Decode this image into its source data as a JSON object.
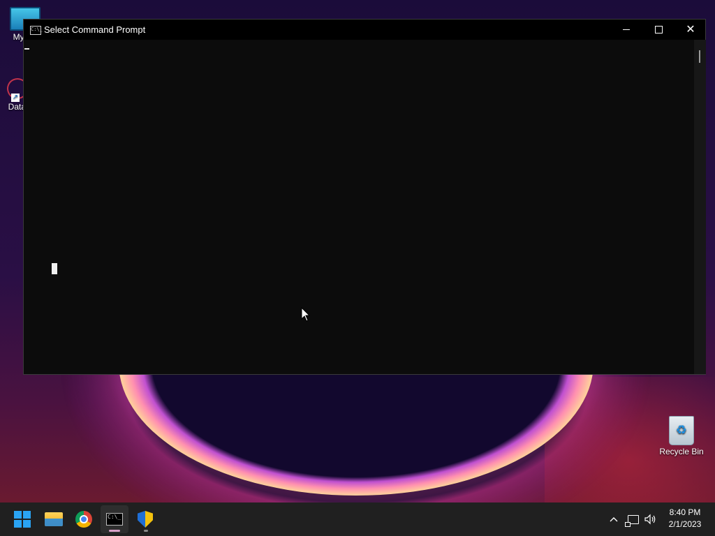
{
  "desktop": {
    "icons": [
      {
        "label": "My Co"
      },
      {
        "label": "DataW"
      },
      {
        "label": "Recycle Bin"
      }
    ]
  },
  "window": {
    "title": "Select Command Prompt",
    "minimize_glyph": "—",
    "maximize_glyph": "☐",
    "close_glyph": "✕"
  },
  "taskbar": {
    "items": [
      {
        "icon": "windows-start-icon",
        "active": false
      },
      {
        "icon": "file-explorer-icon",
        "active": false
      },
      {
        "icon": "chrome-icon",
        "active": false
      },
      {
        "icon": "command-prompt-icon",
        "active": true
      },
      {
        "icon": "security-shield-icon",
        "active": false
      }
    ],
    "tray": {
      "chevron": "^",
      "time": "8:40 PM",
      "date": "2/1/2023"
    }
  },
  "colors": {
    "console_bg": "#0c0c0c",
    "taskbar_bg": "#202020",
    "accent": "#2aa4f4"
  }
}
